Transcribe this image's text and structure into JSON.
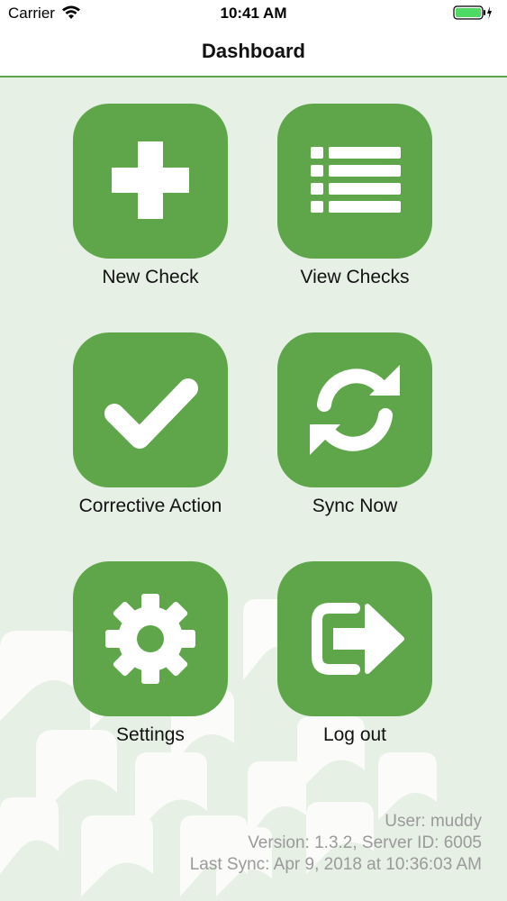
{
  "status_bar": {
    "carrier": "Carrier",
    "time": "10:41 AM",
    "wifi_icon": "wifi-icon",
    "battery_icon": "battery-charging-icon"
  },
  "nav": {
    "title": "Dashboard"
  },
  "theme": {
    "accent": "#5fa64b",
    "background": "#e6f0e4",
    "footer_text": "#9a9a9a"
  },
  "tiles": [
    {
      "label": "New Check",
      "icon": "plus-icon"
    },
    {
      "label": "View Checks",
      "icon": "list-icon"
    },
    {
      "label": "Corrective Action",
      "icon": "checkmark-icon"
    },
    {
      "label": "Sync Now",
      "icon": "sync-icon"
    },
    {
      "label": "Settings",
      "icon": "gear-icon"
    },
    {
      "label": "Log out",
      "icon": "logout-icon"
    }
  ],
  "footer": {
    "user": "User: muddy",
    "version": "Version: 1.3.2, Server ID: 6005",
    "last_sync": "Last Sync: Apr 9, 2018 at 10:36:03 AM"
  }
}
